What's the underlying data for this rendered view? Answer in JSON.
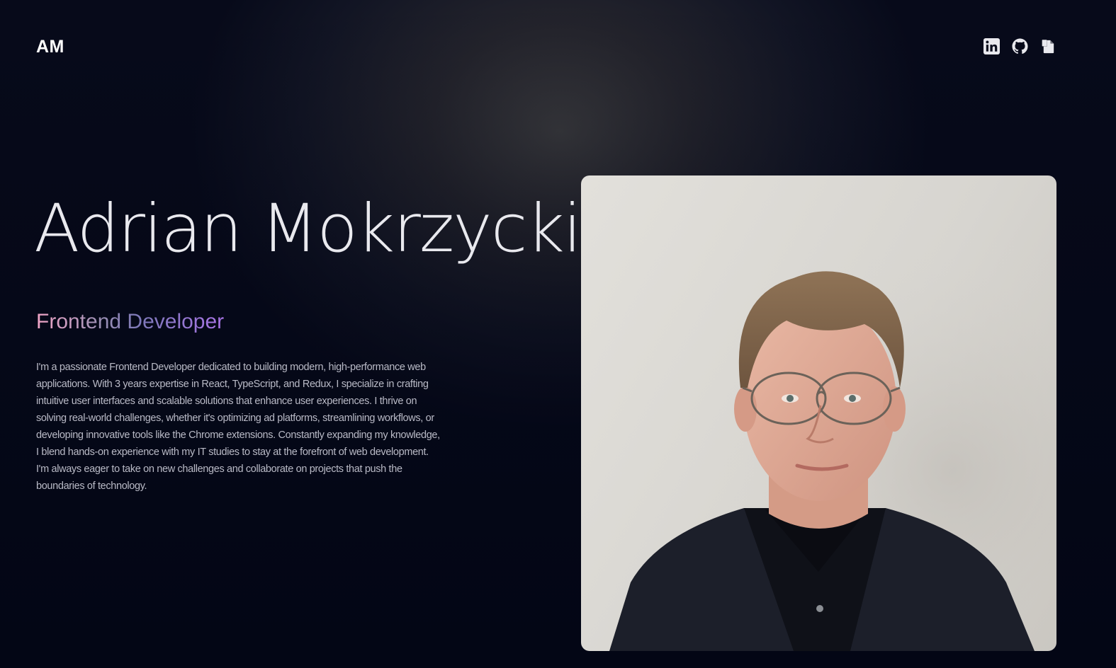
{
  "header": {
    "logo": "AM",
    "social_links": [
      {
        "name": "LinkedIn",
        "icon": "linkedin-icon"
      },
      {
        "name": "GitHub",
        "icon": "github-icon"
      },
      {
        "name": "Resume",
        "icon": "document-icon"
      }
    ]
  },
  "hero": {
    "name": "Adrian Mokrzycki",
    "role": "Frontend Developer",
    "bio": "I'm a passionate Frontend Developer dedicated to building modern, high-performance web applications. With 3 years expertise in React, TypeScript, and Redux, I specialize in crafting intuitive user interfaces and scalable solutions that enhance user experiences. I thrive on solving real-world challenges, whether it's optimizing ad platforms, streamlining workflows, or developing innovative tools like the Chrome extensions. Constantly expanding my knowledge, I blend hands-on experience with my IT studies to stay at the forefront of web development. I'm always eager to take on new challenges and collaborate on projects that push the boundaries of technology."
  },
  "colors": {
    "background": "#060919",
    "text": "#e9e9ee",
    "role_gradient_start": "#f3a6c8",
    "role_gradient_end": "#a874e6"
  }
}
